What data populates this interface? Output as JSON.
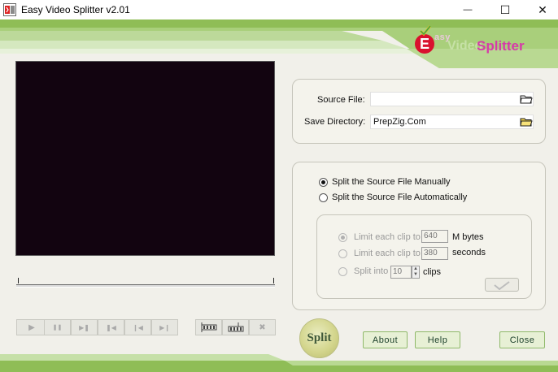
{
  "window": {
    "title": "Easy Video Splitter v2.01",
    "minimize_glyph": "—",
    "maximize_glyph": "☐",
    "close_glyph": "✕"
  },
  "logo": {
    "letter": "E",
    "line1": "asy",
    "word1": "Video",
    "word2": "Splitter"
  },
  "source": {
    "source_file_label": "Source File:",
    "source_file_value": "",
    "save_directory_label": "Save Directory:",
    "save_directory_value": "PrepZig.Com"
  },
  "mode": {
    "manual_label": "Split the Source File Manually",
    "automatic_label": "Split the Source File Automatically",
    "selected": "manual"
  },
  "auto_options": {
    "limit_size_label": "Limit each clip to",
    "limit_size_value": "640",
    "limit_size_unit": "M bytes",
    "limit_time_label": "Limit each clip to",
    "limit_time_value": "380",
    "limit_time_unit": "seconds",
    "split_into_label": "Split into",
    "split_into_value": "10",
    "split_into_unit": "clips",
    "selected": "limit_size",
    "enabled": false
  },
  "transport": {
    "play": "▶",
    "pause": "❚❚",
    "step_forward": "▶❚",
    "step_back": "❚◀",
    "prev": "❙◀",
    "next": "▶❙",
    "delete": "✖"
  },
  "buttons": {
    "split": "Split",
    "about": "About",
    "help": "Help",
    "close": "Close"
  },
  "colors": {
    "skin_green": "#8fbd56",
    "accent_magenta": "#d63aa9",
    "video_bg": "#120410"
  }
}
